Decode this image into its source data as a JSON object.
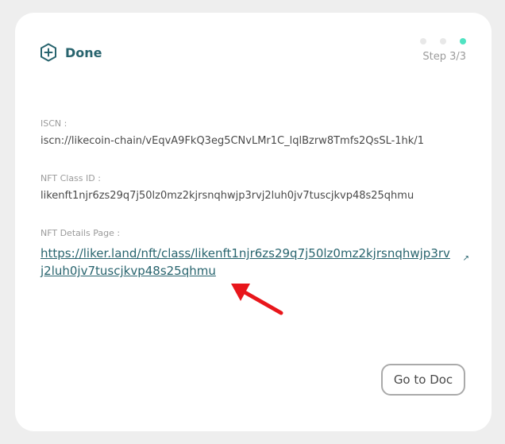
{
  "header": {
    "title": "Done",
    "icon": "plus-circle-hexagon-icon"
  },
  "steps": {
    "label": "Step 3/3",
    "total": 3,
    "current": 3
  },
  "fields": {
    "iscn_label": "ISCN :",
    "iscn_value": "iscn://likecoin-chain/vEqvA9FkQ3eg5CNvLMr1C_lqlBzrw8Tmfs2QsSL-1hk/1",
    "nft_class_label": "NFT Class ID :",
    "nft_class_value": "likenft1njr6zs29q7j50lz0mz2kjrsnqhwjp3rvj2luh0jv7tuscjkvp48s25qhmu",
    "nft_details_label": "NFT Details Page :",
    "nft_details_link": "https://liker.land/nft/class/likenft1njr6zs29q7j50lz0mz2kjrsnqhwjp3rvj2luh0jv7tuscjkvp48s25qhmu"
  },
  "actions": {
    "go_to_doc": "Go to Doc"
  },
  "colors": {
    "accent": "#28646e",
    "step_active": "#50e3c2",
    "arrow": "#e8161b"
  }
}
